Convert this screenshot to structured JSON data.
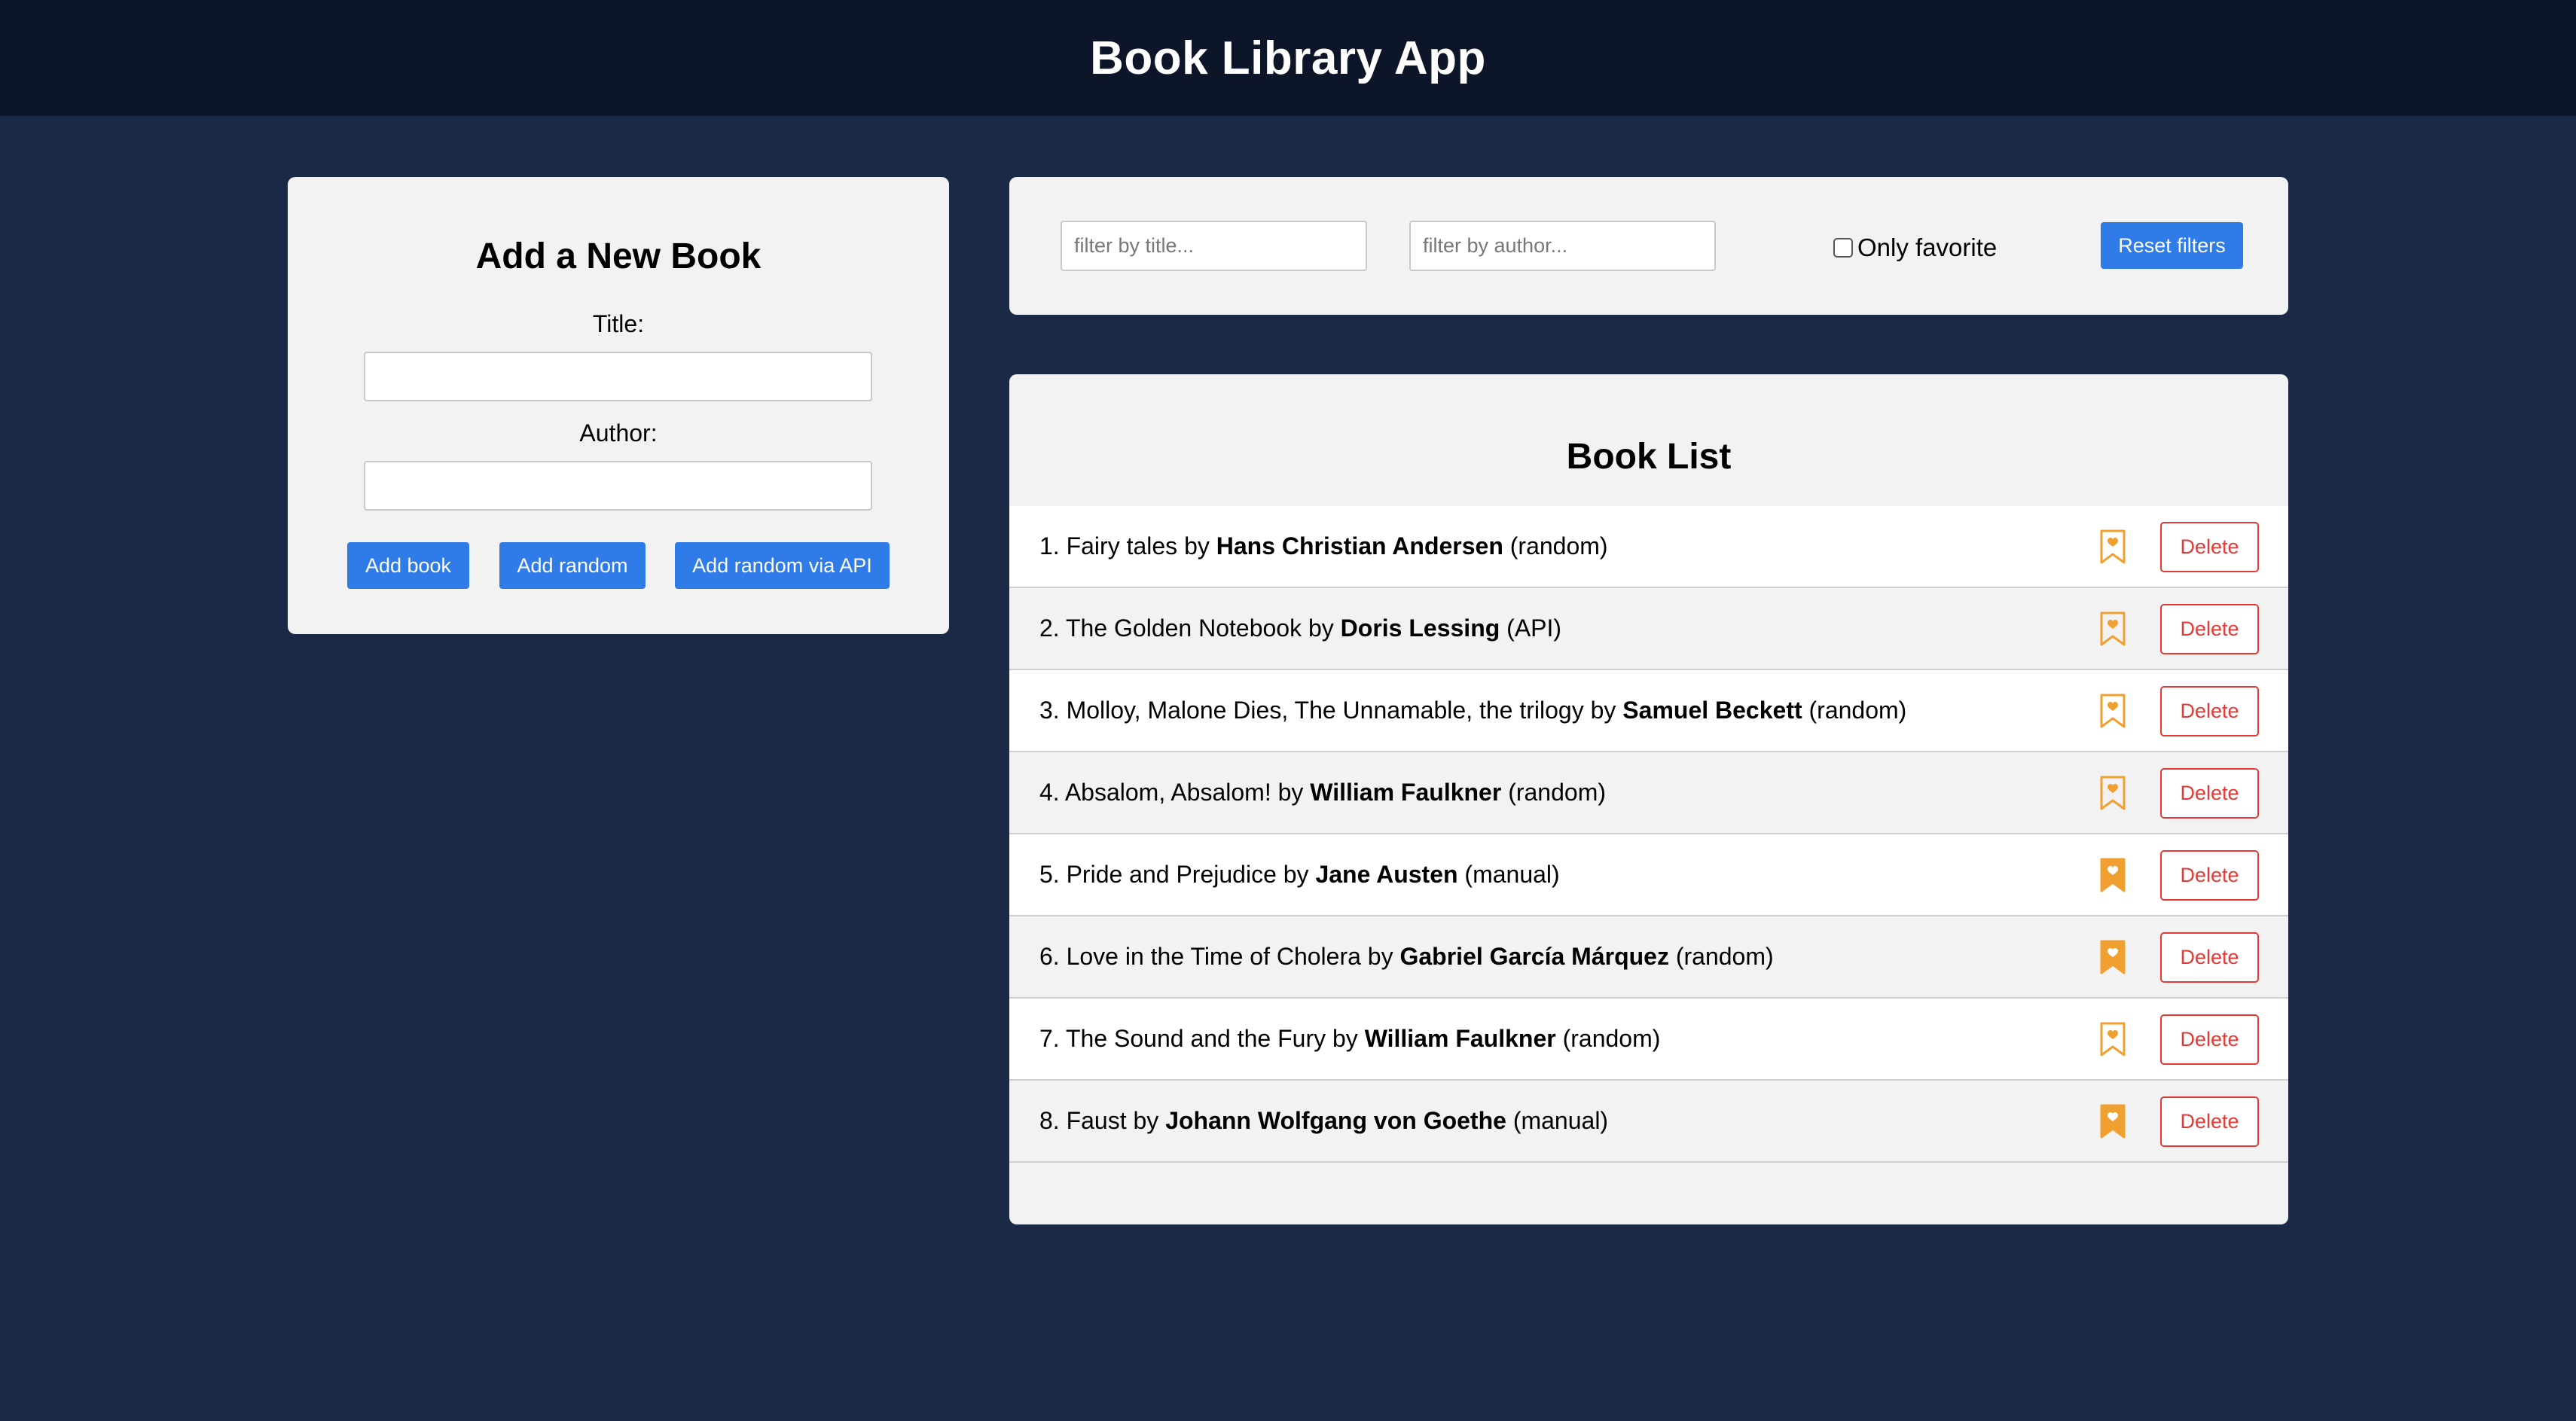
{
  "header": {
    "title": "Book Library App"
  },
  "form": {
    "heading": "Add a New Book",
    "title_label": "Title:",
    "title_value": "",
    "author_label": "Author:",
    "author_value": "",
    "add_book_label": "Add book",
    "add_random_label": "Add random",
    "add_random_api_label": "Add random via API"
  },
  "filters": {
    "title_placeholder": "filter by title...",
    "author_placeholder": "filter by author...",
    "only_favorite_label": "Only favorite",
    "only_favorite_checked": false,
    "reset_label": "Reset filters"
  },
  "book_list": {
    "heading": "Book List",
    "delete_label": "Delete",
    "by_label": "by",
    "books": [
      {
        "index": "1.",
        "title": "Fairy tales",
        "author": "Hans Christian Andersen",
        "source": "(random)",
        "favorite": false
      },
      {
        "index": "2.",
        "title": "The Golden Notebook",
        "author": "Doris Lessing",
        "source": "(API)",
        "favorite": false
      },
      {
        "index": "3.",
        "title": "Molloy, Malone Dies, The Unnamable, the trilogy",
        "author": "Samuel Beckett",
        "source": "(random)",
        "favorite": false
      },
      {
        "index": "4.",
        "title": "Absalom, Absalom!",
        "author": "William Faulkner",
        "source": "(random)",
        "favorite": false
      },
      {
        "index": "5.",
        "title": "Pride and Prejudice",
        "author": "Jane Austen",
        "source": "(manual)",
        "favorite": true
      },
      {
        "index": "6.",
        "title": "Love in the Time of Cholera",
        "author": "Gabriel García Márquez",
        "source": "(random)",
        "favorite": true
      },
      {
        "index": "7.",
        "title": "The Sound and the Fury",
        "author": "William Faulkner",
        "source": "(random)",
        "favorite": false
      },
      {
        "index": "8.",
        "title": "Faust",
        "author": "Johann Wolfgang von Goethe",
        "source": "(manual)",
        "favorite": true
      }
    ]
  },
  "colors": {
    "background": "#1a2a46",
    "header": "#0d1628",
    "accent": "#2f7be8",
    "favorite": "#f0a030",
    "danger": "#e53935"
  }
}
